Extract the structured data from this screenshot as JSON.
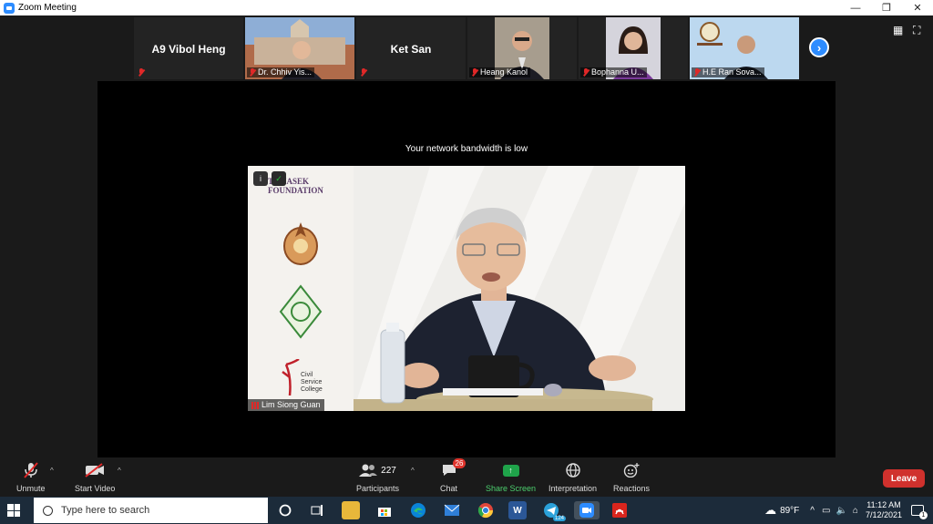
{
  "window": {
    "title": "Zoom Meeting",
    "minimize": "—",
    "restore": "❐",
    "close": "✕"
  },
  "gallery": {
    "participants": [
      {
        "kind": "name-only",
        "name": "A9 Vibol Heng"
      },
      {
        "kind": "video",
        "name": "Dr. Chhiv Yis..."
      },
      {
        "kind": "name-only",
        "name": "Ket San"
      },
      {
        "kind": "video",
        "name": "Heang Kanol"
      },
      {
        "kind": "video",
        "name": "Bophanna U..."
      },
      {
        "kind": "video",
        "name": "H.E Ran Sova..."
      }
    ],
    "next_icon": "›",
    "grid_icon": "▦",
    "fullscreen_icon": "⛶"
  },
  "main": {
    "bandwidth_message": "Your network bandwidth is low",
    "speaker_name": "Lim Siong Guan",
    "logo_text_1": "TEMASEK",
    "logo_text_2": "FOUNDATION",
    "logo_text_3": "Civil",
    "logo_text_4": "Service",
    "logo_text_5": "College",
    "info_icon": "i",
    "shield_icon": "✓"
  },
  "toolbar": {
    "unmute": "Unmute",
    "start_video": "Start Video",
    "participants": "Participants",
    "participants_count": "227",
    "chat": "Chat",
    "chat_badge": "26",
    "share_screen": "Share Screen",
    "interpretation": "Interpretation",
    "reactions": "Reactions",
    "leave": "Leave",
    "caret": "^"
  },
  "taskbar": {
    "search_placeholder": "Type here to search",
    "weather": "89°F",
    "time": "11:12 AM",
    "date": "7/12/2021",
    "notification_count": "1",
    "telegram_badge": "124",
    "colors": {
      "edge": "#0a84d8",
      "chrome": "#e0473a",
      "word": "#2b5797",
      "telegram": "#2aa1da",
      "zoom": "#2d8cff",
      "acrobat": "#d9251d"
    }
  }
}
